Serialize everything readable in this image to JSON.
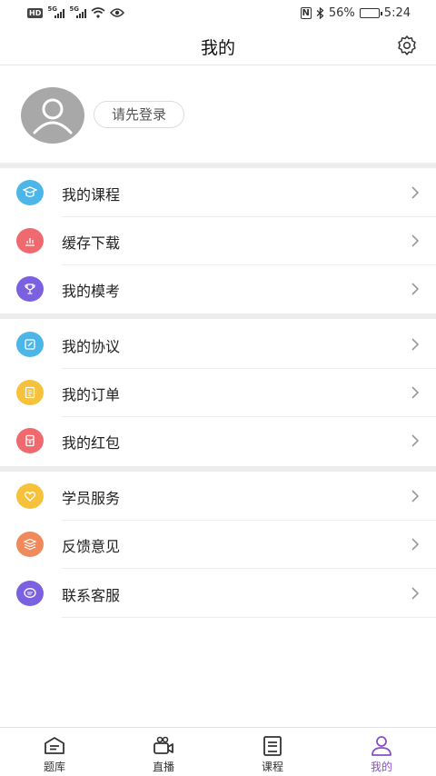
{
  "status_bar": {
    "hd_badge": "HD",
    "network_1": "5G",
    "network_2": "5G",
    "nfc": "N",
    "battery": "56%",
    "battery_level": 0.56,
    "time": "5:24"
  },
  "header": {
    "title": "我的"
  },
  "profile": {
    "login_label": "请先登录"
  },
  "menu": {
    "group1": [
      {
        "label": "我的课程",
        "icon": "graduation-cap-icon",
        "color": "#4db6e8"
      },
      {
        "label": "缓存下载",
        "icon": "bar-chart-icon",
        "color": "#ef6a6f"
      },
      {
        "label": "我的模考",
        "icon": "trophy-icon",
        "color": "#7b61e0"
      }
    ],
    "group2": [
      {
        "label": "我的协议",
        "icon": "edit-document-icon",
        "color": "#4db6e8"
      },
      {
        "label": "我的订单",
        "icon": "order-list-icon",
        "color": "#f7c23b"
      },
      {
        "label": "我的红包",
        "icon": "red-envelope-icon",
        "color": "#ef6a6f"
      }
    ],
    "group3": [
      {
        "label": "学员服务",
        "icon": "heart-icon",
        "color": "#f7c23b"
      },
      {
        "label": "反馈意见",
        "icon": "stack-icon",
        "color": "#f08a5d"
      },
      {
        "label": "联系客服",
        "icon": "chat-bubble-icon",
        "color": "#7b61e0"
      }
    ]
  },
  "tabbar": {
    "tabs": [
      {
        "label": "题库",
        "icon": "question-bank-icon"
      },
      {
        "label": "直播",
        "icon": "live-camera-icon"
      },
      {
        "label": "课程",
        "icon": "course-book-icon"
      },
      {
        "label": "我的",
        "icon": "person-icon",
        "active": true
      }
    ],
    "active_color": "#8a4fc6"
  }
}
